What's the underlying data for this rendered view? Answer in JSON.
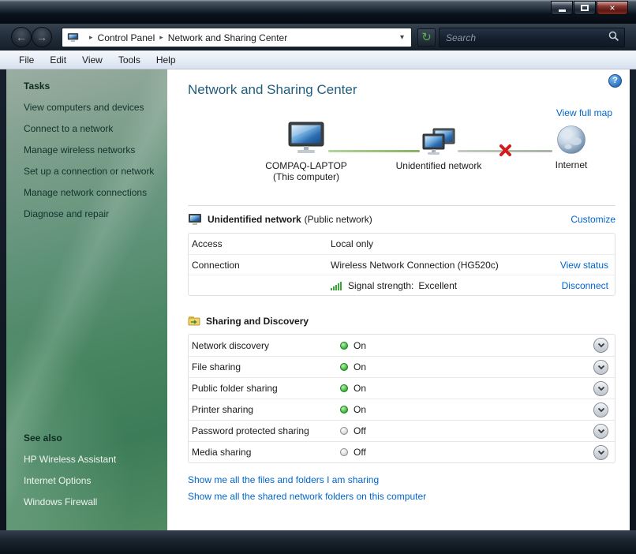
{
  "window": {
    "caption": {
      "close_glyph": "×"
    }
  },
  "navbar": {
    "back_glyph": "←",
    "forward_glyph": "→",
    "breadcrumb": [
      "Control Panel",
      "Network and Sharing Center"
    ],
    "crumb_separator": "▸",
    "dropdown_glyph": "▾",
    "refresh_glyph": "↻",
    "search_placeholder": "Search"
  },
  "menubar": {
    "items": [
      "File",
      "Edit",
      "View",
      "Tools",
      "Help"
    ]
  },
  "sidebar": {
    "tasks_header": "Tasks",
    "tasks": [
      "View computers and devices",
      "Connect to a network",
      "Manage wireless networks",
      "Set up a connection or network",
      "Manage network connections",
      "Diagnose and repair"
    ],
    "see_also_header": "See also",
    "see_also": [
      "HP Wireless Assistant",
      "Internet Options",
      "Windows Firewall"
    ]
  },
  "main": {
    "title": "Network and Sharing Center",
    "help_glyph": "?",
    "view_full_map": "View full map",
    "map": {
      "computer_name": "COMPAQ-LAPTOP",
      "computer_sub": "(This computer)",
      "network_name": "Unidentified network",
      "internet_label": "Internet"
    },
    "network": {
      "title": "Unidentified network",
      "subtitle": "(Public network)",
      "customize": "Customize",
      "access_label": "Access",
      "access_value": "Local only",
      "connection_label": "Connection",
      "connection_value": "Wireless Network Connection (HG520c)",
      "view_status": "View status",
      "signal_label": "Signal strength:",
      "signal_value": "Excellent",
      "disconnect": "Disconnect"
    },
    "sharing": {
      "title": "Sharing and Discovery",
      "rows": [
        {
          "label": "Network discovery",
          "status": "On"
        },
        {
          "label": "File sharing",
          "status": "On"
        },
        {
          "label": "Public folder sharing",
          "status": "On"
        },
        {
          "label": "Printer sharing",
          "status": "On"
        },
        {
          "label": "Password protected sharing",
          "status": "Off"
        },
        {
          "label": "Media sharing",
          "status": "Off"
        }
      ],
      "links": [
        "Show me all the files and folders I am sharing",
        "Show me all the shared network folders on this computer"
      ]
    }
  },
  "colors": {
    "link": "#0066cc",
    "title": "#215e7d",
    "status_on": "#2e9e2e",
    "status_off": "#9a9a9a"
  }
}
